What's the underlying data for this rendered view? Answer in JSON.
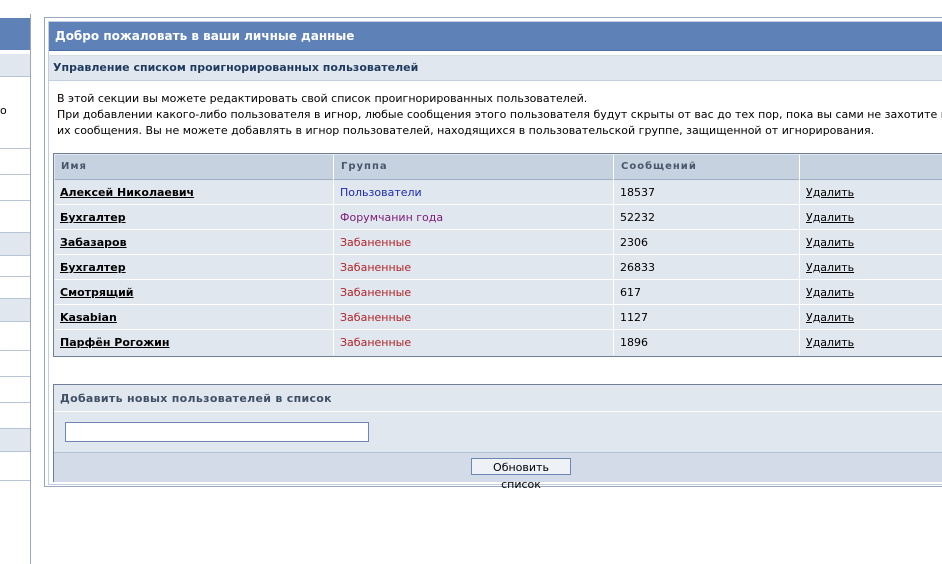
{
  "sidebar": {
    "cut_char": "о"
  },
  "panel": {
    "title": "Добро пожаловать в ваши личные данные",
    "subtitle": "Управление списком проигнорированных пользователей",
    "info_line1": "В этой секции вы можете редактировать свой список проигнорированных пользователей.",
    "info_line2": "При добавлении какого-либо пользователя в игнор, любые сообщения этого пользователя будут скрыты от вас до тех пор, пока вы сами не захотите про",
    "info_line3": "их сообщения. Вы не можете добавлять в игнор пользователей, находящихся в пользовательской группе, защищенной от игнорирования."
  },
  "table": {
    "headers": {
      "name": "Имя",
      "group": "Группа",
      "posts": "Сообщений",
      "action": ""
    },
    "rows": [
      {
        "name": "Алексей Николаевич",
        "group": "Пользователи",
        "group_type": "users",
        "posts": "18537",
        "action": "Удалить"
      },
      {
        "name": "Бухгалтер",
        "group": "Форумчанин года",
        "group_type": "forum",
        "posts": "52232",
        "action": "Удалить"
      },
      {
        "name": "Забазаров",
        "group": "Забаненные",
        "group_type": "banned",
        "posts": "2306",
        "action": "Удалить"
      },
      {
        "name": "Бухгалтер",
        "group": "Забаненные",
        "group_type": "banned",
        "posts": "26833",
        "action": "Удалить"
      },
      {
        "name": "Смотрящий",
        "group": "Забаненные",
        "group_type": "banned",
        "posts": "617",
        "action": "Удалить"
      },
      {
        "name": "Kasabian",
        "group": "Забаненные",
        "group_type": "banned",
        "posts": "1127",
        "action": "Удалить"
      },
      {
        "name": "Парфён Рогожин",
        "group": "Забаненные",
        "group_type": "banned",
        "posts": "1896",
        "action": "Удалить"
      }
    ]
  },
  "add_section": {
    "heading": "Добавить новых пользователей в список",
    "input_value": "",
    "button_label": "Обновить список"
  },
  "colors": {
    "title_bar": "#5e82b8",
    "row_bg": "#e1e7ef",
    "group_users": "#1d2ab5",
    "group_forum": "#7a1a78",
    "group_banned": "#b0232a"
  }
}
